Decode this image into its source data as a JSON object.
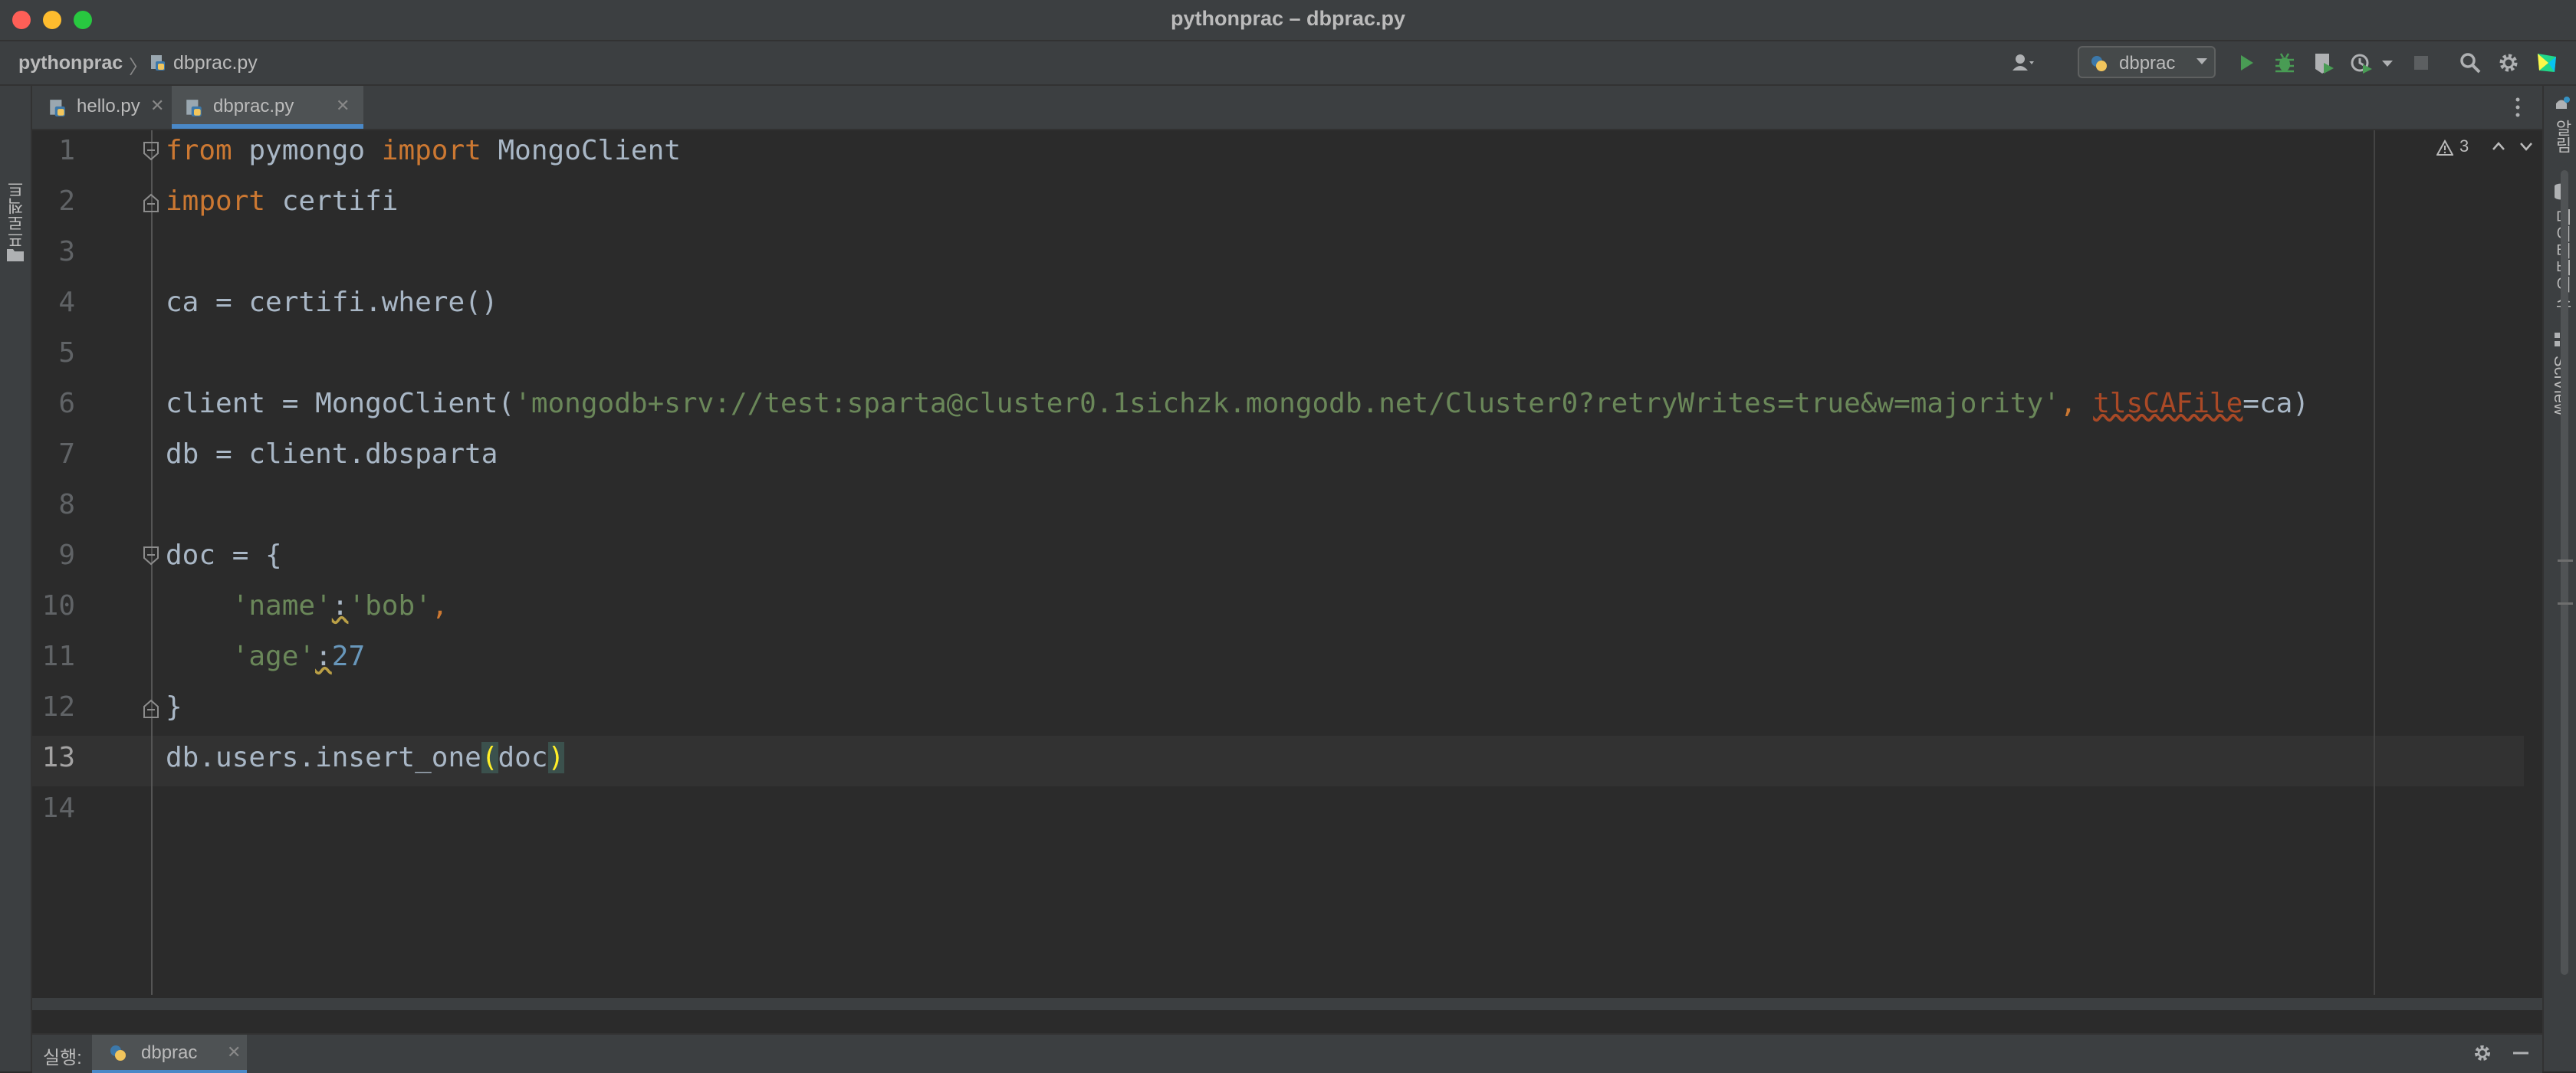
{
  "window": {
    "title": "pythonprac – dbprac.py"
  },
  "breadcrumb": {
    "project": "pythonprac",
    "file": "dbprac.py"
  },
  "run_config": {
    "label": "dbprac"
  },
  "left_stripe": {
    "project_label": "프로젝트"
  },
  "right_stripe": {
    "notifications": "알림",
    "database": "데이터베이스",
    "sciview": "SciView"
  },
  "tabs": [
    {
      "label": "hello.py",
      "active": false
    },
    {
      "label": "dbprac.py",
      "active": true
    }
  ],
  "inspections": {
    "warning_count": "3"
  },
  "editor": {
    "current_line": 13,
    "lines": [
      {
        "num": "1"
      },
      {
        "num": "2"
      },
      {
        "num": "3"
      },
      {
        "num": "4"
      },
      {
        "num": "5"
      },
      {
        "num": "6"
      },
      {
        "num": "7"
      },
      {
        "num": "8"
      },
      {
        "num": "9"
      },
      {
        "num": "10"
      },
      {
        "num": "11"
      },
      {
        "num": "12"
      },
      {
        "num": "13"
      },
      {
        "num": "14"
      }
    ],
    "code": {
      "l1": {
        "kw1": "from",
        "t1": " pymongo ",
        "kw2": "import",
        "t2": " MongoClient"
      },
      "l2": {
        "kw1": "import",
        "t1": " certifi"
      },
      "l4": {
        "t1": "ca = certifi.where()"
      },
      "l6": {
        "t1": "client = MongoClient(",
        "s1": "'mongodb+srv://test:sparta@cluster0.1sichzk.mongodb.net/Cluster0?retryWrites=true&w=majority'",
        "t2": ", ",
        "p1": "tlsCAFile",
        "t3": "=ca)"
      },
      "l7": {
        "t1": "db = client.dbsparta"
      },
      "l9": {
        "t1": "doc = {"
      },
      "l10": {
        "t1": "    ",
        "s1": "'name'",
        "t2": ":",
        "s2": "'bob'",
        "t3": ","
      },
      "l11": {
        "t1": "    ",
        "s1": "'age'",
        "t2": ":",
        "n1": "27"
      },
      "l12": {
        "t1": "}"
      },
      "l13": {
        "t1": "db.users.insert_one",
        "b1": "(",
        "t2": "doc",
        "b2": ")"
      }
    }
  },
  "run_panel": {
    "label": "실행:",
    "tab_label": "dbprac"
  },
  "colors": {
    "background": "#2b2b2b",
    "keyword": "#cc7832",
    "string": "#6a8759",
    "number": "#6897bb",
    "default_text": "#a9b7c6",
    "accent": "#4a88c7",
    "run_green": "#499c54"
  },
  "icons": [
    "python-file-icon",
    "user-icon",
    "run-icon",
    "debug-icon",
    "coverage-icon",
    "profile-icon",
    "stop-icon",
    "search-icon",
    "gear-icon",
    "jetbrains-logo-icon",
    "warning-icon",
    "chevron-up-icon",
    "chevron-down-icon",
    "folder-icon",
    "database-icon",
    "sciview-icon",
    "minimize-icon",
    "more-vert-icon",
    "fold-icon"
  ]
}
